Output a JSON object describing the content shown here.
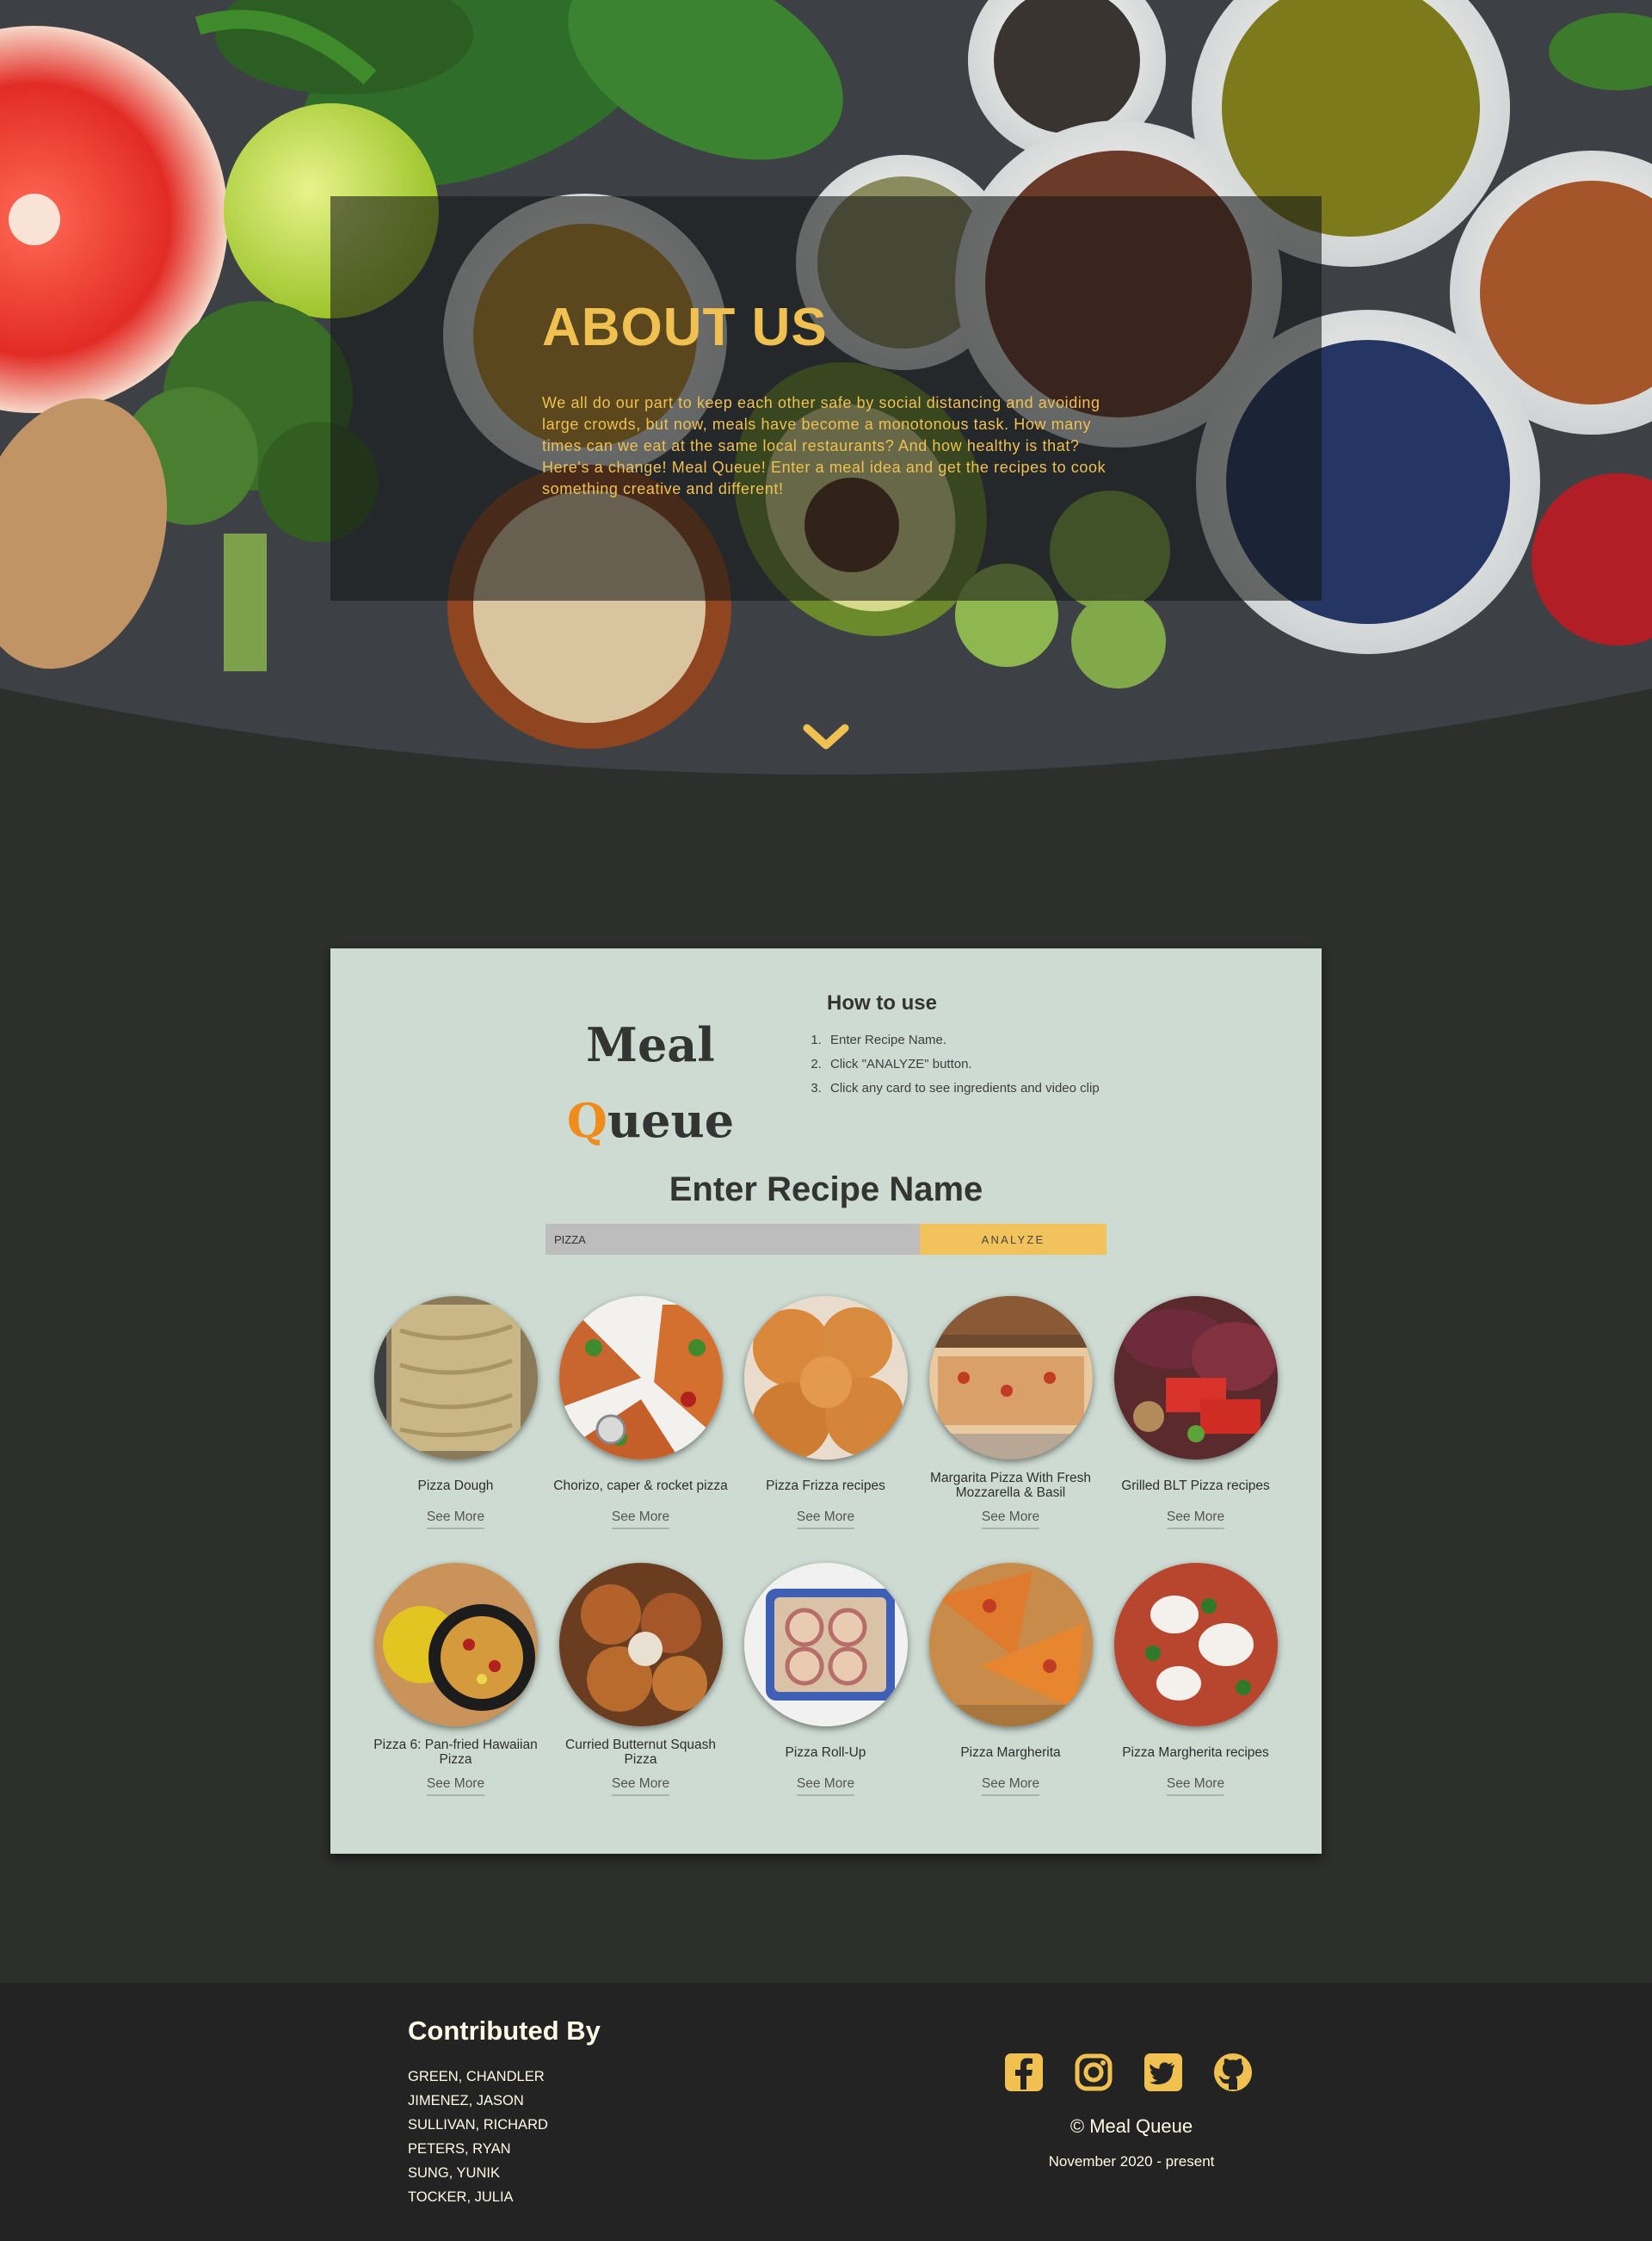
{
  "about": {
    "title": "ABOUT US",
    "text": "We all do our part to keep each other safe by social distancing and avoiding large crowds, but now, meals have become a monotonous task. How many times can we eat at the same local restaurants? And how healthy is that? Here's a change! Meal Queue! Enter a meal idea and get the recipes to cook something creative and different!",
    "scroll_icon": "chevron-down-icon"
  },
  "logo": {
    "line1": "Meal",
    "q": "Q",
    "rest": "ueue"
  },
  "howto": {
    "title": "How to use",
    "steps": [
      "Enter Recipe Name.",
      "Click \"ANALYZE\" button.",
      "Click any card to see ingredients and video clip"
    ]
  },
  "search": {
    "title": "Enter Recipe Name",
    "value": "PIZZA",
    "button": "ANALYZE"
  },
  "recipes": [
    {
      "name": "Pizza Dough",
      "see_more": "See More"
    },
    {
      "name": "Chorizo, caper & rocket pizza",
      "see_more": "See More"
    },
    {
      "name": "Pizza Frizza recipes",
      "see_more": "See More"
    },
    {
      "name": "Margarita Pizza With Fresh Mozzarella & Basil",
      "see_more": "See More"
    },
    {
      "name": "Grilled BLT Pizza recipes",
      "see_more": "See More"
    },
    {
      "name": "Pizza 6: Pan-fried Hawaiian Pizza",
      "see_more": "See More"
    },
    {
      "name": "Curried Butternut Squash Pizza",
      "see_more": "See More"
    },
    {
      "name": "Pizza Roll-Up",
      "see_more": "See More"
    },
    {
      "name": "Pizza Margherita",
      "see_more": "See More"
    },
    {
      "name": "Pizza Margherita recipes",
      "see_more": "See More"
    }
  ],
  "footer": {
    "title": "Contributed By",
    "contributors": [
      "GREEN, CHANDLER",
      "JIMENEZ, JASON",
      "SULLIVAN, RICHARD",
      "PETERS, RYAN",
      "SUNG, YUNIK",
      "TOCKER, JULIA"
    ],
    "social_icons": [
      "facebook-icon",
      "instagram-icon",
      "twitter-icon",
      "github-icon"
    ],
    "copyright": "© Meal Queue",
    "dates": "November 2020 - present"
  },
  "colors": {
    "accent": "#f0c050",
    "logo_q": "#f08c1a",
    "background": "#2d2f2c",
    "card": "#cddbd3",
    "footer": "#222322",
    "search_input": "#bdbdbd",
    "analyze_button": "#f2c35c"
  }
}
